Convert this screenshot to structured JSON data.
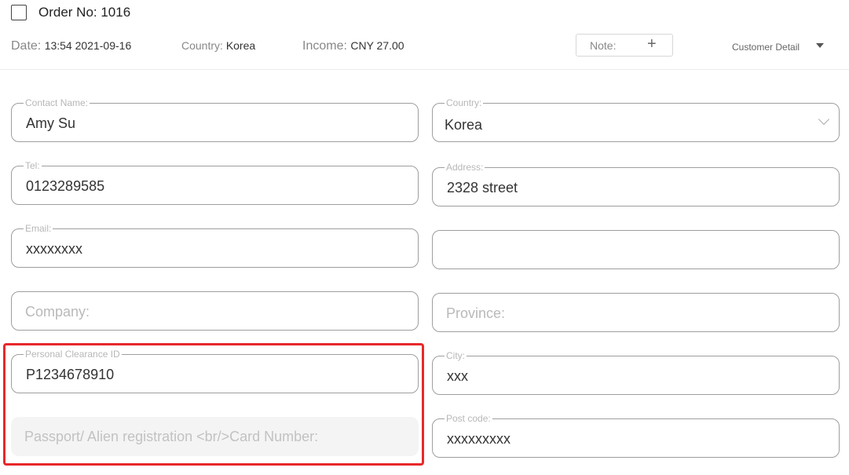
{
  "header": {
    "order_title": "Order No: 1016",
    "date_label": "Date: ",
    "date_value": "13:54 2021-09-16",
    "country_label": "Country: ",
    "country_value": "Korea",
    "income_label": "Income: ",
    "income_value": "CNY 27.00",
    "note_label": "Note:",
    "note_icon": "+",
    "customer_detail": "Customer Detail"
  },
  "form": {
    "contact_name": {
      "label": "Contact Name:",
      "value": "Amy Su"
    },
    "tel": {
      "label": "Tel:",
      "value": "0123289585"
    },
    "email": {
      "label": "Email:",
      "value": "xxxxxxxx"
    },
    "company": {
      "placeholder": "Company:"
    },
    "clearance_id": {
      "label": "Personal Clearance ID",
      "value": "P1234678910"
    },
    "passport": {
      "placeholder": "Passport/ Alien registration <br/>Card Number:"
    },
    "country": {
      "label": "Country:",
      "value": "Korea"
    },
    "address": {
      "label": "Address:",
      "value": "2328 street"
    },
    "address2": {
      "value": ""
    },
    "province": {
      "placeholder": "Province:"
    },
    "city": {
      "label": "City:",
      "value": "xxx"
    },
    "post_code": {
      "label": "Post code:",
      "value": "xxxxxxxxx"
    }
  },
  "icons": {
    "checkbox": "checkbox-icon",
    "plus": "plus-icon",
    "caret": "caret-down-icon",
    "chevron": "chevron-down-icon"
  },
  "colors": {
    "highlight": "#e8282a",
    "border": "#9e9e9e",
    "placeholder": "#b9b9b9"
  }
}
